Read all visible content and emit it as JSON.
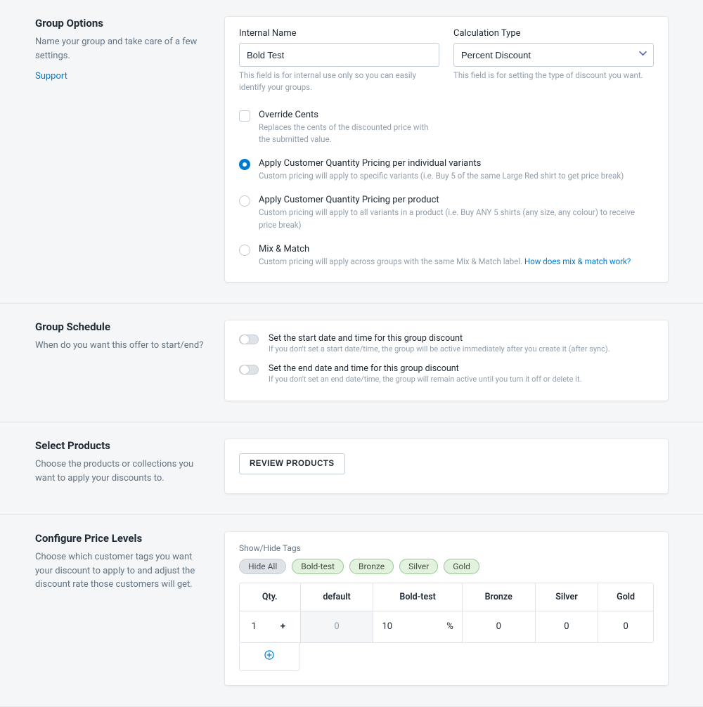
{
  "groupOptions": {
    "title": "Group Options",
    "desc": "Name your group and take care of a few settings.",
    "supportLink": "Support",
    "internalNameLabel": "Internal Name",
    "internalNameValue": "Bold Test",
    "internalNameHelp": "This field is for internal use only so you can easily identify your groups.",
    "calcTypeLabel": "Calculation Type",
    "calcTypeValue": "Percent Discount",
    "calcTypeHelp": "This field is for setting the type of discount you want.",
    "opts": [
      {
        "type": "checkbox",
        "checked": false,
        "title": "Override Cents",
        "desc": "Replaces the cents of the discounted price with the submitted value."
      },
      {
        "type": "radio",
        "checked": true,
        "title": "Apply Customer Quantity Pricing per individual variants",
        "desc": "Custom pricing will apply to specific variants (i.e. Buy 5 of the same Large Red shirt to get price break)"
      },
      {
        "type": "radio",
        "checked": false,
        "title": "Apply Customer Quantity Pricing per product",
        "desc": "Custom pricing will apply to all variants in a product (i.e. Buy ANY 5 shirts (any size, any colour) to receive price break)"
      },
      {
        "type": "radio",
        "checked": false,
        "title": "Mix & Match",
        "desc": "Custom pricing will apply across groups with the same Mix & Match label. ",
        "link": "How does mix & match work?"
      }
    ]
  },
  "groupSchedule": {
    "title": "Group Schedule",
    "desc": "When do you want this offer to start/end?",
    "startTitle": "Set the start date and time for this group discount",
    "startDesc": "If you don't set a start date/time, the group will be active immediately after you create it (after sync).",
    "endTitle": "Set the end date and time for this group discount",
    "endDesc": "If you don't set an end date/time, the group will remain active until you turn it off or delete it."
  },
  "selectProducts": {
    "title": "Select Products",
    "desc": "Choose the products or collections you want to apply your discounts to.",
    "button": "REVIEW PRODUCTS"
  },
  "priceLevels": {
    "title": "Configure Price Levels",
    "desc": "Choose which customer tags you want your discount to apply to and adjust the discount rate those customers will get.",
    "tagsLabel": "Show/Hide Tags",
    "tags": [
      "Hide All",
      "Bold-test",
      "Bronze",
      "Silver",
      "Gold"
    ],
    "headers": [
      "Qty.",
      "default",
      "Bold-test",
      "Bronze",
      "Silver",
      "Gold"
    ],
    "row": {
      "qty": "1",
      "qtyPlus": "+",
      "default": "0",
      "boldtest": "10",
      "boldtestUnit": "%",
      "bronze": "0",
      "silver": "0",
      "gold": "0"
    }
  }
}
